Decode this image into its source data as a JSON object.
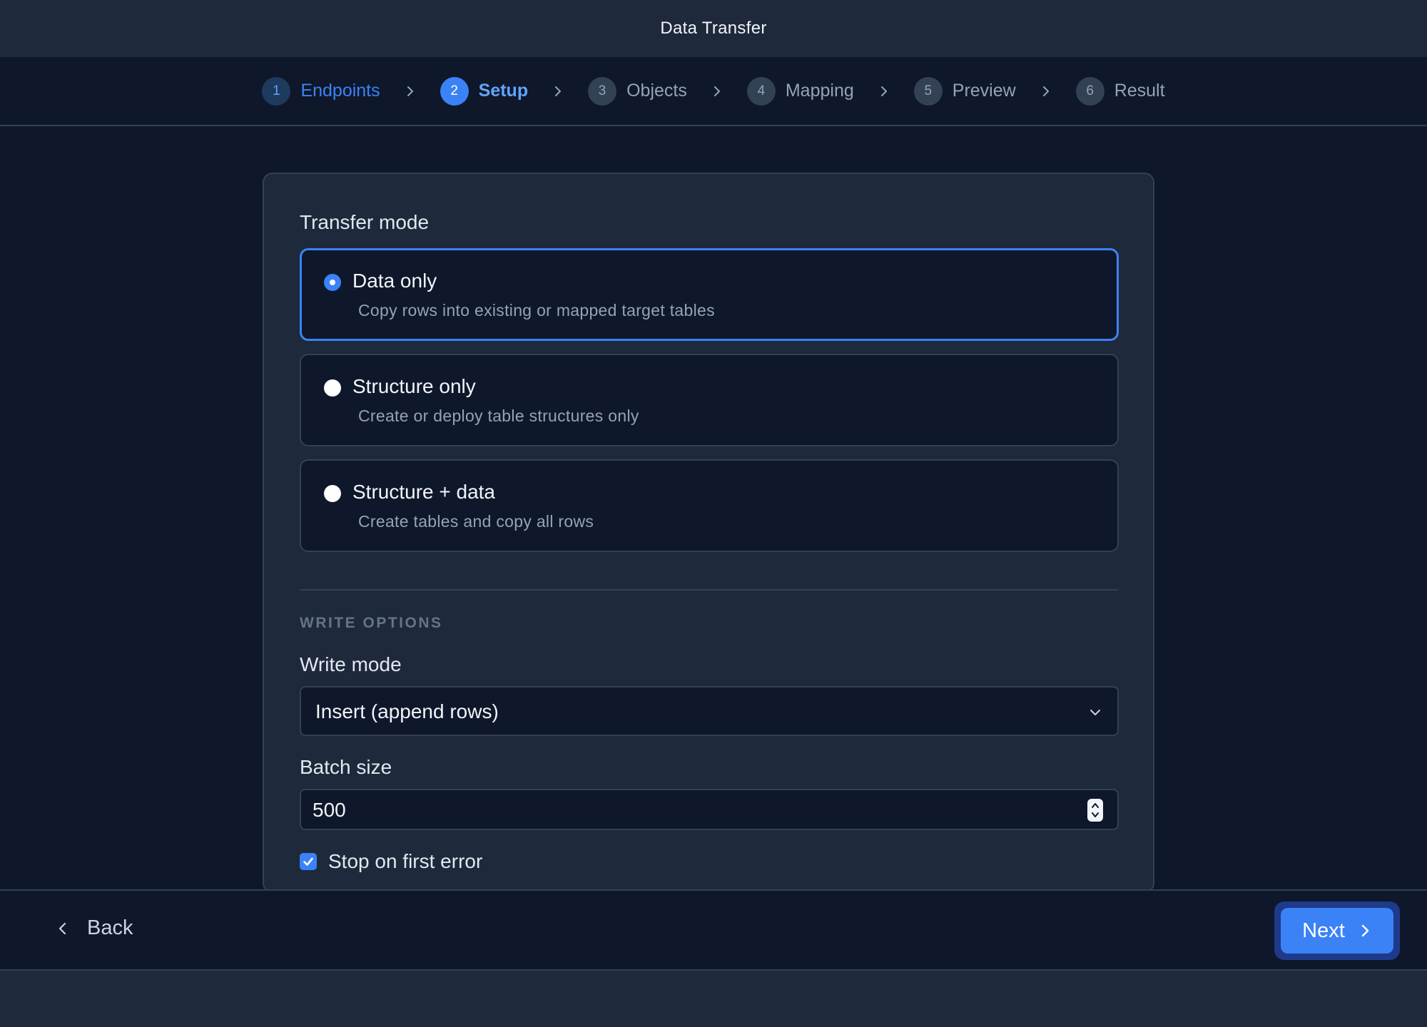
{
  "window": {
    "title": "Data Transfer"
  },
  "steps": [
    {
      "number": "1",
      "label": "Endpoints",
      "state": "done"
    },
    {
      "number": "2",
      "label": "Setup",
      "state": "active"
    },
    {
      "number": "3",
      "label": "Objects",
      "state": "pending"
    },
    {
      "number": "4",
      "label": "Mapping",
      "state": "pending"
    },
    {
      "number": "5",
      "label": "Preview",
      "state": "pending"
    },
    {
      "number": "6",
      "label": "Result",
      "state": "pending"
    }
  ],
  "transfer_mode": {
    "label": "Transfer mode",
    "options": [
      {
        "title": "Data only",
        "description": "Copy rows into existing or mapped target tables",
        "selected": true
      },
      {
        "title": "Structure only",
        "description": "Create or deploy table structures only",
        "selected": false
      },
      {
        "title": "Structure + data",
        "description": "Create tables and copy all rows",
        "selected": false
      }
    ]
  },
  "write_options": {
    "heading": "WRITE OPTIONS",
    "write_mode": {
      "label": "Write mode",
      "value": "Insert (append rows)"
    },
    "batch_size": {
      "label": "Batch size",
      "value": "500"
    },
    "stop_on_error": {
      "label": "Stop on first error",
      "checked": true
    }
  },
  "footer": {
    "back_label": "Back",
    "next_label": "Next"
  },
  "colors": {
    "accent": "#3b82f6",
    "background": "#0f172a",
    "panel": "#1e293b",
    "border": "#334155"
  },
  "icons": {
    "step_separator": "chevron-right-icon",
    "select": "chevron-down-icon",
    "spinner": "spinner-arrows-icon",
    "checkbox": "check-icon",
    "back": "chevron-left-icon",
    "next": "chevron-right-icon"
  }
}
